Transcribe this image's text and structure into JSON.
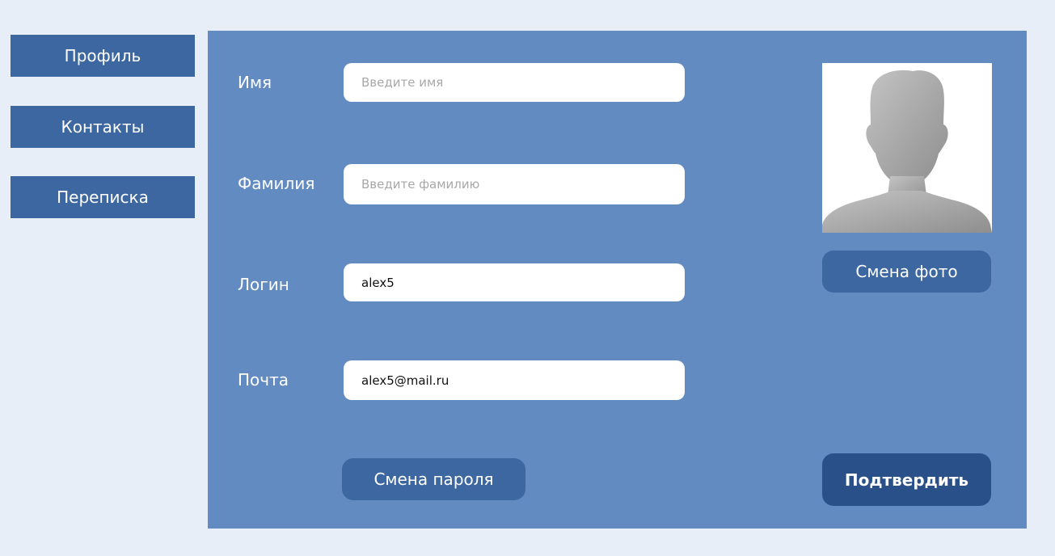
{
  "sidebar": {
    "items": [
      {
        "label": "Профиль"
      },
      {
        "label": "Контакты"
      },
      {
        "label": "Переписка"
      }
    ]
  },
  "form": {
    "first_name": {
      "label": "Имя",
      "value": "",
      "placeholder": "Введите имя"
    },
    "last_name": {
      "label": "Фамилия",
      "value": "",
      "placeholder": "Введите фамилию"
    },
    "login": {
      "label": "Логин",
      "value": "alex5",
      "placeholder": ""
    },
    "email": {
      "label": "Почта",
      "value": "alex5@mail.ru",
      "placeholder": ""
    }
  },
  "photo": {
    "icon": "user-silhouette-icon",
    "change_label": "Смена фото"
  },
  "actions": {
    "change_password_label": "Смена пароля",
    "confirm_label": "Подтвердить"
  },
  "colors": {
    "page_bg": "#e8eef8",
    "panel_bg": "#628bc2",
    "button_bg": "#3d67a0",
    "confirm_bg": "#2a5089"
  }
}
